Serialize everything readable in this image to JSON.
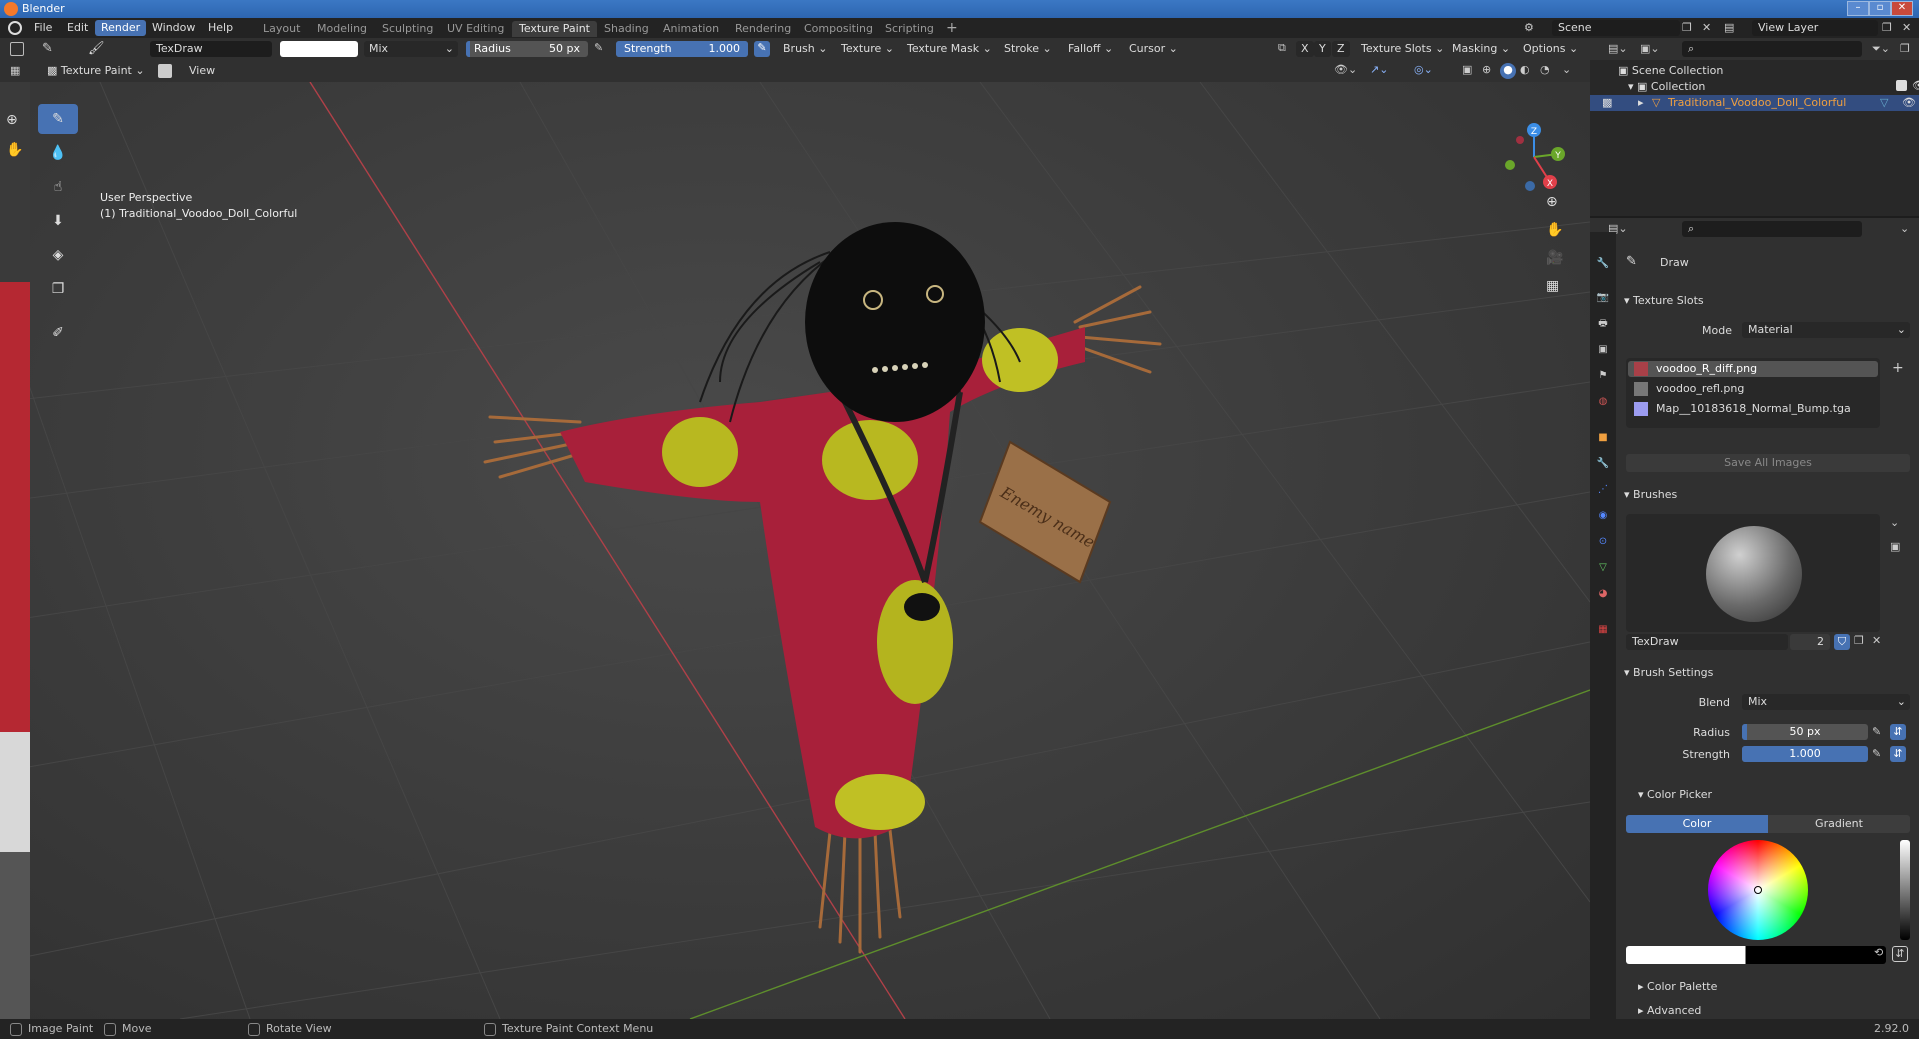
{
  "window": {
    "title": "Blender"
  },
  "menus": [
    "File",
    "Edit",
    "Render",
    "Window",
    "Help"
  ],
  "workspaces": [
    "Layout",
    "Modeling",
    "Sculpting",
    "UV Editing",
    "Texture Paint",
    "Shading",
    "Animation",
    "Rendering",
    "Compositing",
    "Scripting"
  ],
  "active_workspace": "Texture Paint",
  "scene": {
    "name": "Scene",
    "view_layer": "View Layer"
  },
  "tool_header": {
    "brush_name": "TexDraw",
    "blend": "Mix",
    "radius_label": "Radius",
    "radius_value": "50 px",
    "strength_label": "Strength",
    "strength_value": "1.000",
    "strength_fraction": 1.0,
    "menus": [
      "Brush",
      "Texture",
      "Texture Mask",
      "Stroke",
      "Falloff",
      "Cursor"
    ],
    "axes": [
      "X",
      "Y",
      "Z"
    ],
    "right_menus": [
      "Texture Slots",
      "Masking",
      "Options"
    ]
  },
  "view_header": {
    "mode": "Texture Paint",
    "view_menu": "View"
  },
  "viewport": {
    "perspective": "User Perspective",
    "object_label": "(1) Traditional_Voodoo_Doll_Colorful",
    "tag_text": "Enemy name",
    "gizmo": {
      "x": "X",
      "y": "Y",
      "z": "Z"
    }
  },
  "outliner": {
    "scene_collection": "Scene Collection",
    "collection": "Collection",
    "object": "Traditional_Voodoo_Doll_Colorful"
  },
  "properties": {
    "tool_name": "Draw",
    "texture_slots_header": "Texture Slots",
    "mode_label": "Mode",
    "mode_value": "Material",
    "slots": [
      "voodoo_R_diff.png",
      "voodoo_refl.png",
      "Map__10183618_Normal_Bump.tga"
    ],
    "save_all": "Save All Images",
    "brushes_header": "Brushes",
    "brush_name": "TexDraw",
    "brush_users": "2",
    "brush_settings_header": "Brush Settings",
    "blend_label": "Blend",
    "blend_value": "Mix",
    "radius_label": "Radius",
    "radius_value": "50 px",
    "strength_label": "Strength",
    "strength_value": "1.000",
    "color_picker_header": "Color Picker",
    "color_tab": "Color",
    "gradient_tab": "Gradient",
    "color_palette": "Color Palette",
    "advanced": "Advanced"
  },
  "statusbar": {
    "items": [
      "Image Paint",
      "Move",
      "Rotate View",
      "Texture Paint Context Menu"
    ],
    "version": "2.92.0"
  },
  "colors": {
    "accent": "#4772b3",
    "doll_red": "#a8203a",
    "pattern_yellow": "#c8d020",
    "x_axis": "#e0404a",
    "y_axis": "#6aa62a",
    "z_axis": "#3b8ee6"
  }
}
